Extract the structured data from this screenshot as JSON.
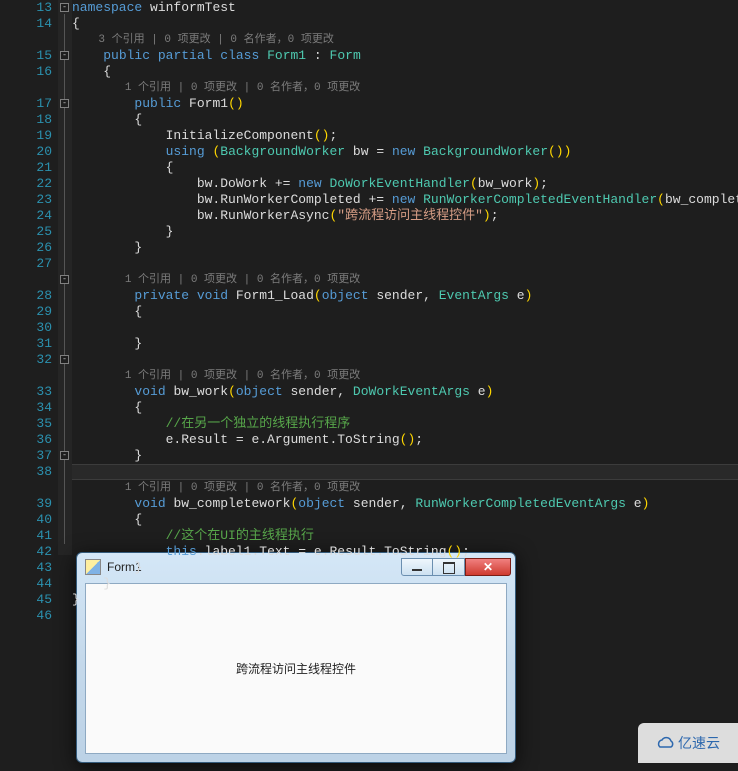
{
  "code": {
    "l13": {
      "ns": "namespace",
      "name": "winformTest"
    },
    "l14": "{",
    "codelens_class": "3 个引用 | 0 项更改 | 0 名作者，0 项更改",
    "l15": {
      "public": "public",
      "partial": "partial",
      "class": "class",
      "name": "Form1",
      "colon": ":",
      "base": "Form"
    },
    "l16": "{",
    "codelens_ctor": "1 个引用 | 0 项更改 | 0 名作者，0 项更改",
    "l17": {
      "public": "public",
      "name": "Form1",
      "parens": "()"
    },
    "l18": "{",
    "l19": {
      "call": "InitializeComponent",
      "parens": "()",
      "semi": ";"
    },
    "l20": {
      "using": "using",
      "lp": "(",
      "type": "BackgroundWorker",
      "var": "bw",
      "eq": "=",
      "new": "new",
      "type2": "BackgroundWorker",
      "parens": "()",
      "rp": ")"
    },
    "l21": "{",
    "l22": {
      "lhs": "bw.DoWork",
      "op": "+=",
      "new": "new",
      "type": "DoWorkEventHandler",
      "lp": "(",
      "arg": "bw_work",
      "rp": ")",
      "semi": ";"
    },
    "l23": {
      "lhs": "bw.RunWorkerCompleted",
      "op": "+=",
      "new": "new",
      "type": "RunWorkerCompletedEventHandler",
      "lp": "(",
      "arg": "bw_completework",
      "rp": ")",
      "semi": ";"
    },
    "l24": {
      "lhs": "bw.RunWorkerAsync",
      "lp": "(",
      "str": "\"跨流程访问主线程控件\"",
      "rp": ")",
      "semi": ";"
    },
    "l25": "}",
    "l26": "}",
    "codelens_load": "1 个引用 | 0 项更改 | 0 名作者，0 项更改",
    "l28": {
      "private": "private",
      "void": "void",
      "name": "Form1_Load",
      "lp": "(",
      "objkw": "object",
      "p1": "sender,",
      "t2": "EventArgs",
      "p2": "e",
      "rp": ")"
    },
    "l29": "{",
    "l31": "}",
    "codelens_work": "1 个引用 | 0 项更改 | 0 名作者，0 项更改",
    "l33": {
      "void": "void",
      "name": "bw_work",
      "lp": "(",
      "objkw": "object",
      "p1": "sender,",
      "t2": "DoWorkEventArgs",
      "p2": "e",
      "rp": ")"
    },
    "l34": "{",
    "l35": {
      "cmt": "//在另一个独立的线程执行程序"
    },
    "l36": {
      "expr": "e.Result = e.Argument.ToString",
      "parens": "()",
      "semi": ";"
    },
    "l37": "}",
    "codelens_cw": "1 个引用 | 0 项更改 | 0 名作者，0 项更改",
    "l39": {
      "void": "void",
      "name": "bw_completework",
      "lp": "(",
      "objkw": "object",
      "p1": "sender,",
      "t2": "RunWorkerCompletedEventArgs",
      "p2": "e",
      "rp": ")"
    },
    "l40": "{",
    "l41": {
      "cmt": "//这个在UI的主线程执行"
    },
    "l42": {
      "this": "this",
      "dot": ".",
      "expr": "label1.Text = e.Result.ToString",
      "parens": "()",
      "semi": ";"
    },
    "l43": "}",
    "l44": "}",
    "l45": "}",
    "line_numbers": [
      "13",
      "14",
      "",
      "15",
      "16",
      "",
      "17",
      "18",
      "19",
      "20",
      "21",
      "22",
      "23",
      "24",
      "25",
      "26",
      "27",
      "",
      "28",
      "29",
      "30",
      "31",
      "32",
      "",
      "33",
      "34",
      "35",
      "36",
      "37",
      "38",
      "",
      "39",
      "40",
      "41",
      "42",
      "43",
      "44",
      "45",
      "46"
    ]
  },
  "winform": {
    "title": "Form1",
    "label_text": "跨流程访问主线程控件"
  },
  "watermark": "亿速云"
}
